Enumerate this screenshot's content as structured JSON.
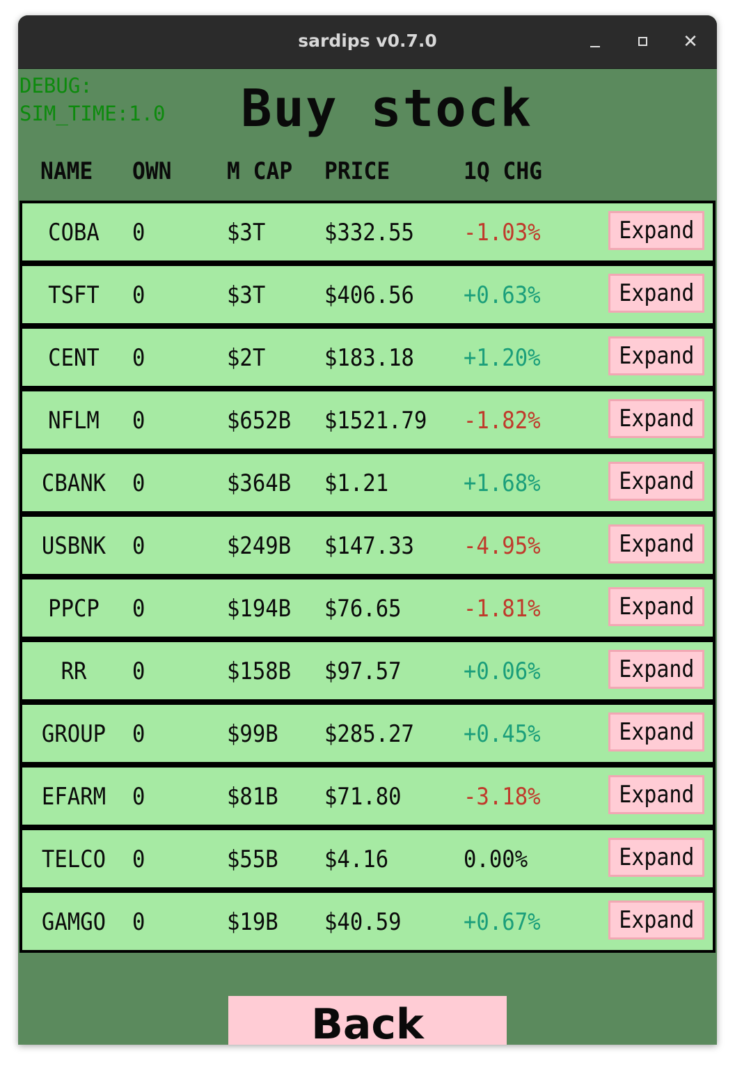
{
  "window": {
    "title": "sardips v0.7.0"
  },
  "debug": {
    "line1": "DEBUG:",
    "line2": "SIM_TIME:1.0"
  },
  "page": {
    "heading": "Buy stock",
    "back_label": "Back"
  },
  "columns": {
    "name": "NAME",
    "own": "OWN",
    "mcap": "M CAP",
    "price": "PRICE",
    "chg": "1Q CHG"
  },
  "colors": {
    "row_bg": "#a6eaa3",
    "positive": "#1a9e7a",
    "negative": "#c0392b",
    "button_bg": "#ffccd5",
    "window_bg": "#5b8a5d"
  },
  "rows": [
    {
      "name": "COBA",
      "own": "0",
      "mcap": "$3T",
      "price": "$332.55",
      "chg": "-1.03%",
      "dir": "neg",
      "action": "Expand"
    },
    {
      "name": "TSFT",
      "own": "0",
      "mcap": "$3T",
      "price": "$406.56",
      "chg": "+0.63%",
      "dir": "pos",
      "action": "Expand"
    },
    {
      "name": "CENT",
      "own": "0",
      "mcap": "$2T",
      "price": "$183.18",
      "chg": "+1.20%",
      "dir": "pos",
      "action": "Expand"
    },
    {
      "name": "NFLM",
      "own": "0",
      "mcap": "$652B",
      "price": "$1521.79",
      "chg": "-1.82%",
      "dir": "neg",
      "action": "Expand"
    },
    {
      "name": "CBANK",
      "own": "0",
      "mcap": "$364B",
      "price": "$1.21",
      "chg": "+1.68%",
      "dir": "pos",
      "action": "Expand"
    },
    {
      "name": "USBNK",
      "own": "0",
      "mcap": "$249B",
      "price": "$147.33",
      "chg": "-4.95%",
      "dir": "neg",
      "action": "Expand"
    },
    {
      "name": "PPCP",
      "own": "0",
      "mcap": "$194B",
      "price": "$76.65",
      "chg": "-1.81%",
      "dir": "neg",
      "action": "Expand"
    },
    {
      "name": "RR",
      "own": "0",
      "mcap": "$158B",
      "price": "$97.57",
      "chg": "+0.06%",
      "dir": "pos",
      "action": "Expand"
    },
    {
      "name": "GROUP",
      "own": "0",
      "mcap": "$99B",
      "price": "$285.27",
      "chg": "+0.45%",
      "dir": "pos",
      "action": "Expand"
    },
    {
      "name": "EFARM",
      "own": "0",
      "mcap": "$81B",
      "price": "$71.80",
      "chg": "-3.18%",
      "dir": "neg",
      "action": "Expand"
    },
    {
      "name": "TELCO",
      "own": "0",
      "mcap": "$55B",
      "price": "$4.16",
      "chg": "0.00%",
      "dir": "zero",
      "action": "Expand"
    },
    {
      "name": "GAMGO",
      "own": "0",
      "mcap": "$19B",
      "price": "$40.59",
      "chg": "+0.67%",
      "dir": "pos",
      "action": "Expand"
    }
  ]
}
